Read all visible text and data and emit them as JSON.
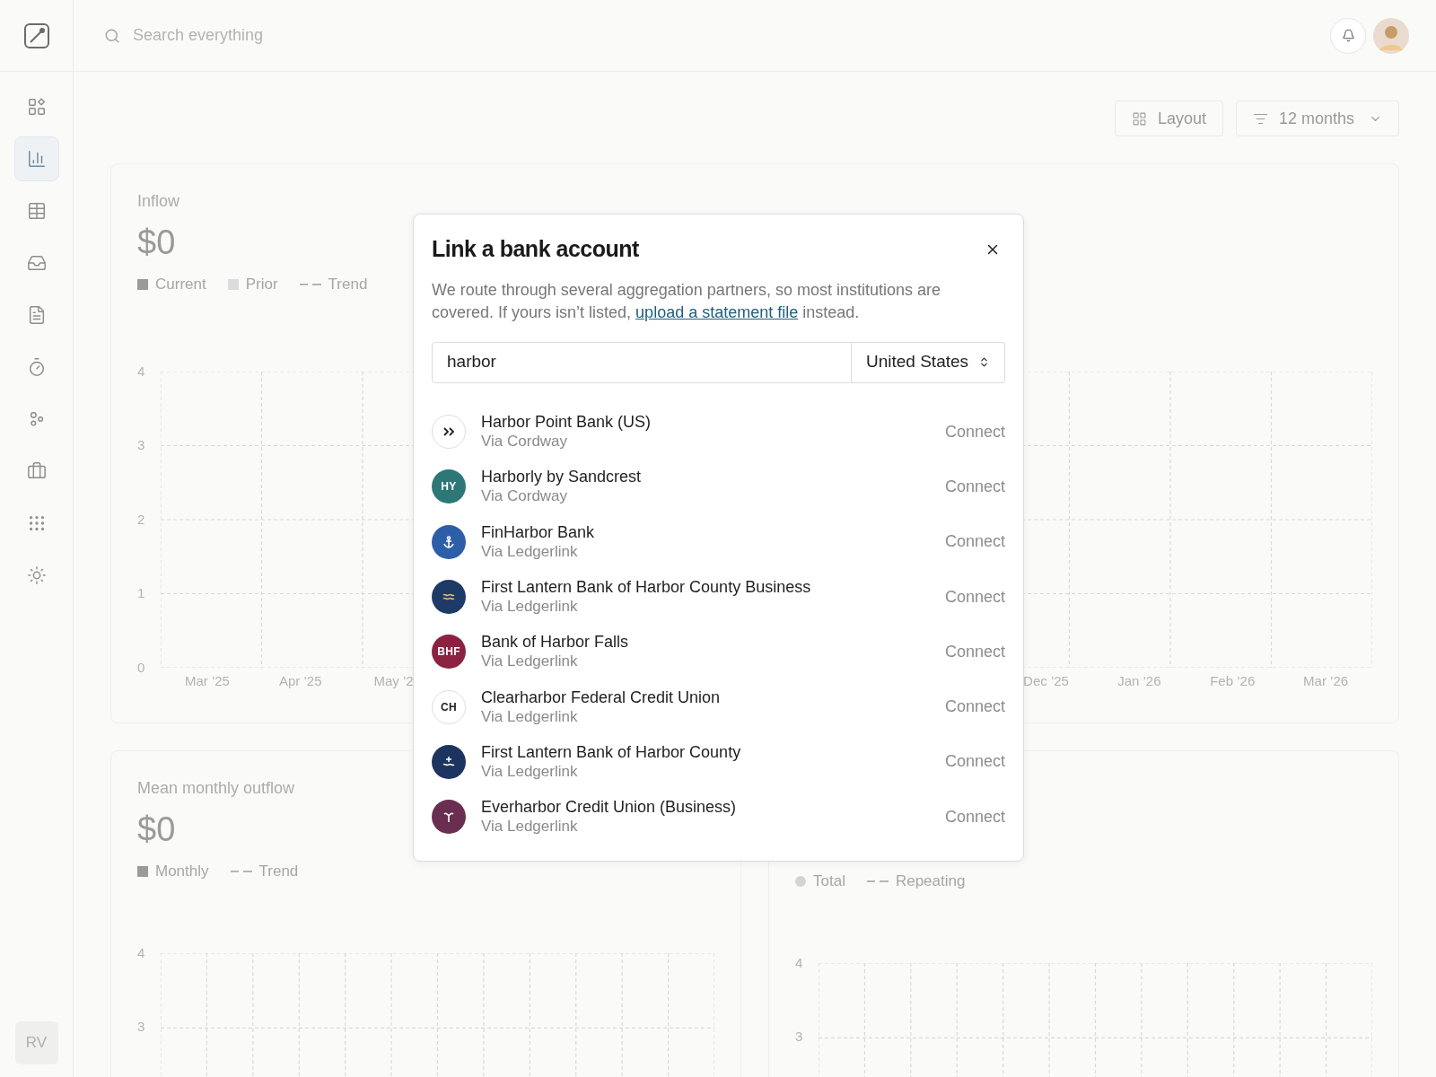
{
  "search": {
    "placeholder": "Search everything"
  },
  "sidebar": {
    "items": [
      {
        "selected": false
      },
      {
        "selected": true
      },
      {
        "selected": false
      },
      {
        "selected": false
      },
      {
        "selected": false
      },
      {
        "selected": false
      },
      {
        "selected": false
      },
      {
        "selected": false
      },
      {
        "selected": false
      },
      {
        "selected": false
      }
    ],
    "user_initials": "RV"
  },
  "toolbar": {
    "layout_button": "Layout",
    "period_select": "12 months"
  },
  "inflow_card": {
    "title": "Inflow",
    "amount": "$0",
    "legend": [
      {
        "kind": "square",
        "label": "Current",
        "color": "#9a9a9a"
      },
      {
        "kind": "square",
        "label": "Prior",
        "color": "#dcdcdc"
      },
      {
        "kind": "dash",
        "label": "Trend",
        "color": "#b5b5b5"
      }
    ],
    "yticks": [
      "4",
      "3",
      "2",
      "1",
      "0"
    ],
    "x_labels_start": [
      "Mar ’25",
      "Apr ’25",
      "May ’2"
    ],
    "x_labels_end": [
      "Dec ’25",
      "Jan ’26",
      "Feb ’26",
      "Mar ’26"
    ]
  },
  "outflow_card": {
    "title": "Mean monthly outflow",
    "amount": "$0",
    "legend": [
      {
        "kind": "square",
        "label": "Monthly",
        "color": "#9a9a9a"
      },
      {
        "kind": "dash",
        "label": "Trend",
        "color": "#b5b5b5"
      }
    ],
    "yticks": [
      "4",
      "3"
    ]
  },
  "third_card": {
    "legend": [
      {
        "kind": "dot",
        "label": "Total",
        "color": "#d4d4d4"
      },
      {
        "kind": "dash",
        "label": "Repeating",
        "color": "#b5b5b5"
      }
    ],
    "yticks": [
      "4",
      "3"
    ]
  },
  "dialog": {
    "title": "Link a bank account",
    "description_start": "We route through several aggregation partners, so most institutions are covered. If yours isn’t listed,",
    "link": "upload a statement file",
    "description_end": "instead.",
    "search_value": "harbor",
    "country": "United States",
    "institutions": [
      {
        "name": "Harbor Point Bank (US)",
        "via": "Via Cordway",
        "kind": "chevrons",
        "color": "#ffffff",
        "action": "Connect"
      },
      {
        "name": "Harborly by Sandcrest",
        "via": "Via Cordway",
        "kind": "initials",
        "initials": "HY",
        "color": "#2e7777",
        "action": "Connect"
      },
      {
        "name": "FinHarbor Bank",
        "via": "Via Ledgerlink",
        "kind": "anchor",
        "color": "#2d5ea8",
        "action": "Connect"
      },
      {
        "name": "First Lantern Bank of Harbor County Business",
        "via": "Via Ledgerlink",
        "kind": "waves",
        "color": "#1e3a66",
        "action": "Connect"
      },
      {
        "name": "Bank of Harbor Falls",
        "via": "Via Ledgerlink",
        "kind": "initials",
        "initials": "BHF",
        "color": "#8c2240",
        "action": "Connect"
      },
      {
        "name": "Clearharbor Federal Credit Union",
        "via": "Via Ledgerlink",
        "kind": "initials",
        "initials": "CH",
        "color": "#ffffff",
        "action": "Connect"
      },
      {
        "name": "First Lantern Bank of Harbor County",
        "via": "Via Ledgerlink",
        "kind": "swimmer",
        "color": "#1d3461",
        "action": "Connect"
      },
      {
        "name": "Everharbor Credit Union (Business)",
        "via": "Via Ledgerlink",
        "kind": "sprout",
        "color": "#6a2e50",
        "action": "Connect"
      }
    ]
  }
}
